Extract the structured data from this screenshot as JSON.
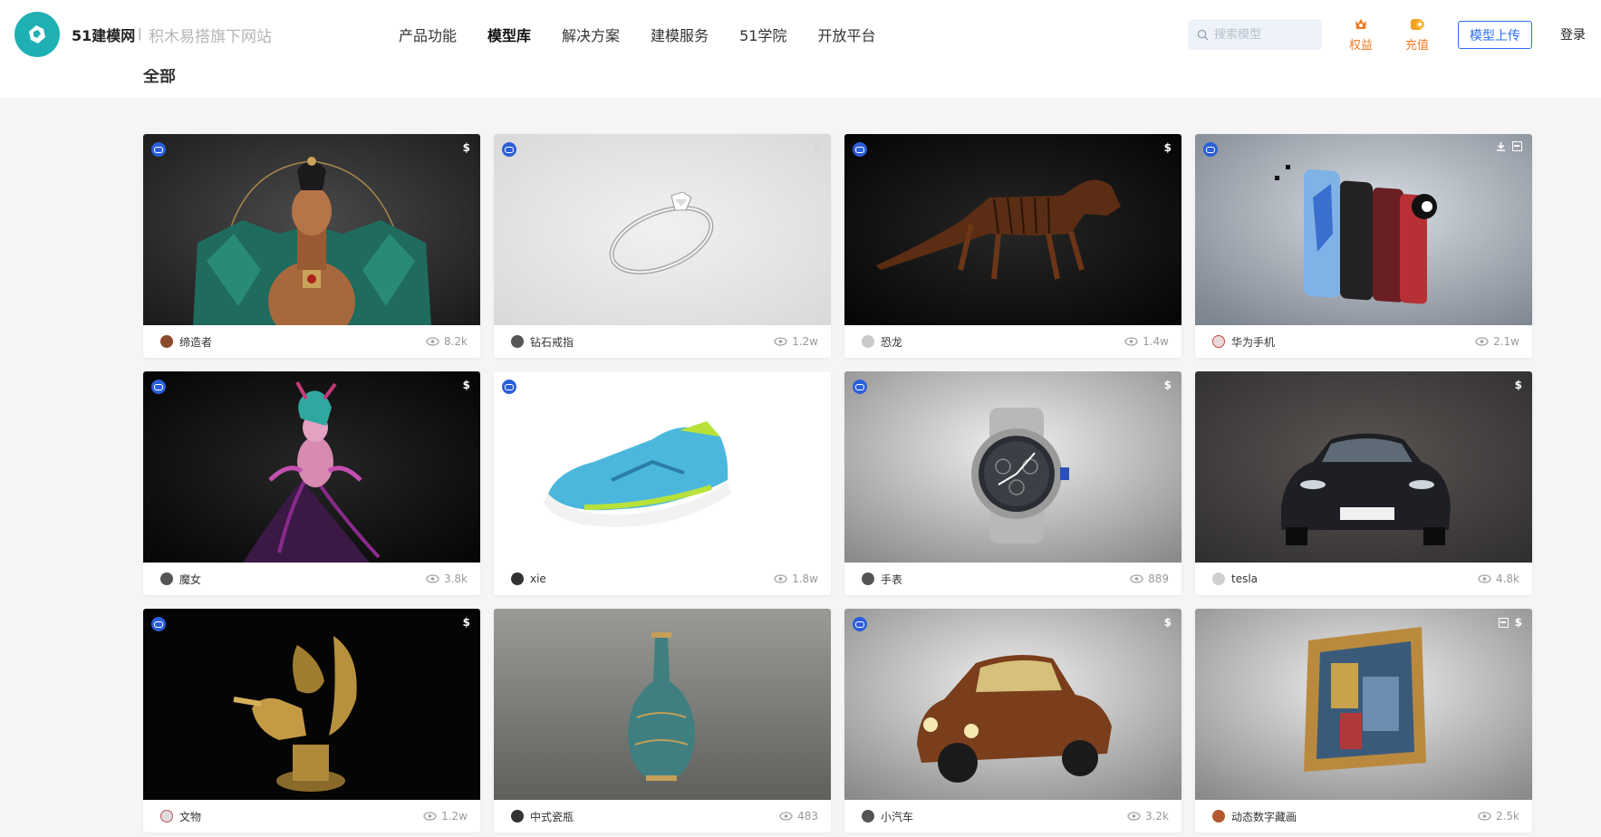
{
  "header": {
    "brand": "51建模网",
    "brand_separator": "|",
    "brand_sub": "积木易搭旗下网站",
    "nav": [
      {
        "label": "产品功能",
        "active": false
      },
      {
        "label": "模型库",
        "active": true
      },
      {
        "label": "解决方案",
        "active": false
      },
      {
        "label": "建模服务",
        "active": false
      },
      {
        "label": "51学院",
        "active": false
      },
      {
        "label": "开放平台",
        "active": false
      }
    ],
    "search_placeholder": "搜索模型",
    "rights_label": "权益",
    "recharge_label": "充值",
    "upload_label": "模型上传",
    "login_label": "登录"
  },
  "section_title": "全部",
  "colors": {
    "brand": "#1fb0b4",
    "accent_blue": "#2d6ff2",
    "accent_orange": "#f07a26",
    "vr_badge": "#2b5fd9"
  },
  "cards": [
    {
      "name": "缔造者",
      "views": "8.2k",
      "vr": true,
      "tags": [
        "$"
      ],
      "scene": "warrior"
    },
    {
      "name": "钻石戒指",
      "views": "1.2w",
      "vr": true,
      "tags": [
        "$"
      ],
      "scene": "ring"
    },
    {
      "name": "恐龙",
      "views": "1.4w",
      "vr": true,
      "tags": [
        "$"
      ],
      "scene": "dino"
    },
    {
      "name": "华为手机",
      "views": "2.1w",
      "vr": true,
      "tags": [
        "download",
        "film"
      ],
      "scene": "phone"
    },
    {
      "name": "魔女",
      "views": "3.8k",
      "vr": true,
      "tags": [
        "$"
      ],
      "scene": "witch"
    },
    {
      "name": "xie",
      "views": "1.8w",
      "vr": true,
      "tags": [],
      "scene": "shoe"
    },
    {
      "name": "手表",
      "views": "889",
      "vr": true,
      "tags": [
        "$"
      ],
      "scene": "watch"
    },
    {
      "name": "tesla",
      "views": "4.8k",
      "vr": false,
      "tags": [
        "$"
      ],
      "scene": "car"
    },
    {
      "name": "文物",
      "views": "1.2w",
      "vr": true,
      "tags": [
        "$"
      ],
      "scene": "relic"
    },
    {
      "name": "中式瓷瓶",
      "views": "483",
      "vr": false,
      "tags": [],
      "scene": "vase"
    },
    {
      "name": "小汽车",
      "views": "3.2k",
      "vr": true,
      "tags": [
        "$"
      ],
      "scene": "oldcar"
    },
    {
      "name": "动态数字藏画",
      "views": "2.5k",
      "vr": false,
      "tags": [
        "film",
        "$"
      ],
      "scene": "frame"
    }
  ]
}
